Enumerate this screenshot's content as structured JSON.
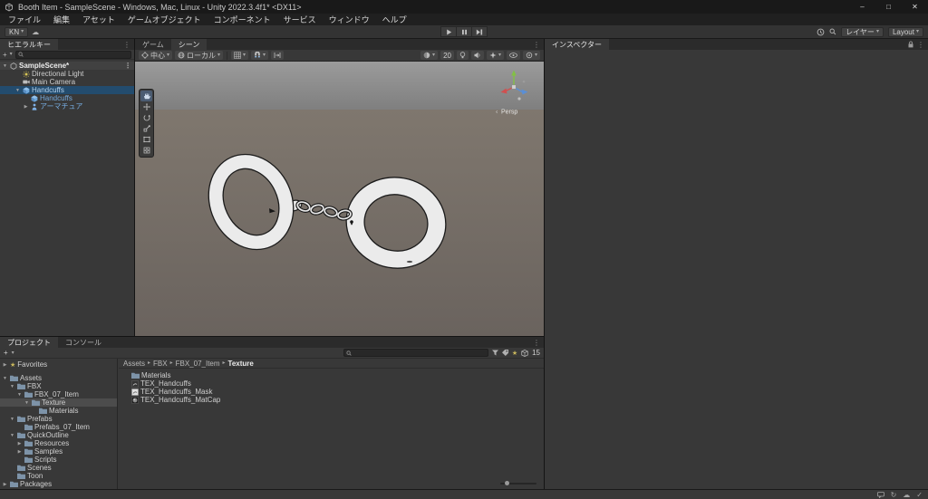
{
  "window": {
    "title": "Booth Item - SampleScene - Windows, Mac, Linux - Unity 2022.3.4f1* <DX11>",
    "minimize": "–",
    "maximize": "□",
    "close": "✕"
  },
  "icons": {
    "caret_down": "▾",
    "expand_open": "▼",
    "expand_closed": "▶",
    "menu_dots": "⋮",
    "plus": "+",
    "star": "★",
    "cloud": "☁",
    "breadcrumb_sep": "▸",
    "persp_toggle": "‹",
    "refresh": "↻",
    "check": "✓"
  },
  "menu": {
    "items": [
      "ファイル",
      "編集",
      "アセット",
      "ゲームオブジェクト",
      "コンポーネント",
      "サービス",
      "ウィンドウ",
      "ヘルプ"
    ]
  },
  "toolbar": {
    "account": "KN",
    "layers": "レイヤー",
    "layout": "Layout"
  },
  "hierarchy": {
    "tab": "ヒエラルキー",
    "items": [
      {
        "label": "SampleScene*"
      },
      {
        "label": "Directional Light"
      },
      {
        "label": "Main Camera"
      },
      {
        "label": "Handcuffs"
      },
      {
        "label": "Handcuffs"
      },
      {
        "label": "アーマチュア"
      }
    ]
  },
  "scene_view": {
    "game_tab": "ゲーム",
    "scene_tab": "シーン",
    "pivot": "中心",
    "space": "ローカル",
    "fov": "20",
    "persp": "Persp"
  },
  "inspector": {
    "tab": "インスペクター"
  },
  "project": {
    "tab": "プロジェクト",
    "console_tab": "コンソール",
    "favorites": "Favorites",
    "tree": [
      {
        "label": "Assets"
      },
      {
        "label": "FBX"
      },
      {
        "label": "FBX_07_Item"
      },
      {
        "label": "Texture"
      },
      {
        "label": "Materials"
      },
      {
        "label": "Prefabs"
      },
      {
        "label": "Prefabs_07_Item"
      },
      {
        "label": "QuickOutline"
      },
      {
        "label": "Resources"
      },
      {
        "label": "Samples"
      },
      {
        "label": "Scripts"
      },
      {
        "label": "Scenes"
      },
      {
        "label": "Toon"
      },
      {
        "label": "Packages"
      }
    ],
    "breadcrumb": [
      "Assets",
      "FBX",
      "FBX_07_Item",
      "Texture"
    ],
    "files": [
      {
        "label": "Materials"
      },
      {
        "label": "TEX_Handcuffs"
      },
      {
        "label": "TEX_Handcuffs_Mask"
      },
      {
        "label": "TEX_Handcuffs_MatCap"
      }
    ],
    "hidden_packages_count": "15"
  }
}
